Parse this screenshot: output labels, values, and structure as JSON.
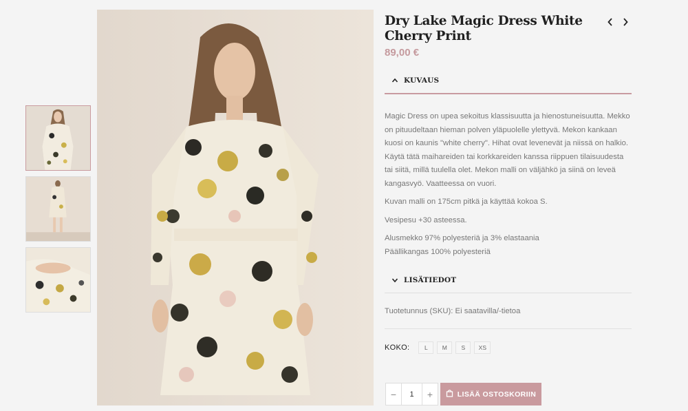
{
  "product": {
    "title": "Dry Lake Magic Dress White Cherry Print",
    "price": "89,00 €"
  },
  "nav": {
    "prev_icon": "chevron-left-icon",
    "next_icon": "chevron-right-icon"
  },
  "sections": {
    "description_label": "KUVAUS",
    "extra_label": "LISÄTIEDOT"
  },
  "description": [
    "Magic Dress on upea sekoitus klassisuutta ja hienostuneisuutta. Mekko on pituudeltaan hieman polven yläpuolelle ylettyvä. Mekon kankaan kuosi on kaunis \"white cherry\". Hihat ovat levenevät ja niissä on halkio. Käytä tätä maihareiden tai korkkareiden kanssa riippuen tilaisuudesta tai siitä, millä tuulella olet. Mekon malli on väljähkö ja siinä on leveä kangasvyö. Vaatteessa on vuori.",
    "Kuvan malli on 175cm pitkä ja käyttää kokoa S.",
    "Vesipesu +30 asteessa.",
    "Alusmekko 97% polyesteriä ja 3% elastaania",
    "Päällikangas 100% polyesteriä"
  ],
  "sku_text": "Tuotetunnus (SKU): Ei saatavilla/-tietoa",
  "sizes": {
    "label": "KOKO:",
    "options": [
      "L",
      "M",
      "S",
      "XS"
    ]
  },
  "quantity": {
    "minus": "−",
    "value": "1",
    "plus": "+"
  },
  "cart_button": "LISÄÄ OSTOSKORIIN",
  "colors": {
    "accent": "#c99a9e",
    "price": "#c59a9e",
    "background": "#f4f4f4"
  }
}
